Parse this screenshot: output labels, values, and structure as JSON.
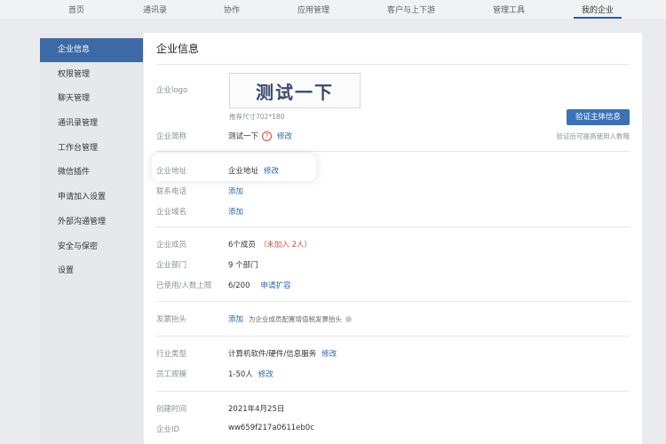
{
  "topnav": {
    "tabs": [
      "首页",
      "通讯录",
      "协作",
      "应用管理",
      "客户与上下游",
      "管理工具",
      "我的企业"
    ],
    "active_index": 6
  },
  "sidebar": {
    "items": [
      "企业信息",
      "权限管理",
      "聊天管理",
      "通讯录管理",
      "工作台管理",
      "微信插件",
      "申请加入设置",
      "外部沟通管理",
      "安全与保密",
      "设置"
    ],
    "active_index": 0
  },
  "main": {
    "title": "企业信息",
    "logo": {
      "label": "企业logo",
      "text": "测试一下",
      "hint": "推荐尺寸702*180"
    },
    "verify": {
      "button": "验证主体信息",
      "hint": "验证后可提高使用人数哦"
    },
    "short_name": {
      "label": "企业简称",
      "value": "测试一下",
      "action": "修改"
    },
    "address": {
      "label": "企业地址",
      "value": "企业地址",
      "action": "修改"
    },
    "phone": {
      "label": "联系电话",
      "action": "添加"
    },
    "domain": {
      "label": "企业域名",
      "action": "添加"
    },
    "members": {
      "label": "企业成员",
      "value": "6个成员",
      "extra": "（未加入 2人）"
    },
    "departments": {
      "label": "企业部门",
      "value": "9 个部门"
    },
    "quota": {
      "label": "已使用/人数上限",
      "value": "6/200",
      "action": "申请扩容"
    },
    "invoice": {
      "label": "发票抬头",
      "action": "添加",
      "tip": "为企业成员配置增值税发票抬头"
    },
    "industry": {
      "label": "行业类型",
      "value": "计算机软件/硬件/信息服务",
      "action": "修改"
    },
    "staff": {
      "label": "员工规模",
      "value": "1-50人",
      "action": "修改"
    },
    "created": {
      "label": "创建时间",
      "value": "2021年4月25日"
    },
    "corp_id": {
      "label": "企业ID",
      "value": "ww659f217a0611eb0c"
    }
  },
  "colors": {
    "accent": "#3c6aa6",
    "link": "#2b64b0",
    "warning": "#d14b3f"
  }
}
